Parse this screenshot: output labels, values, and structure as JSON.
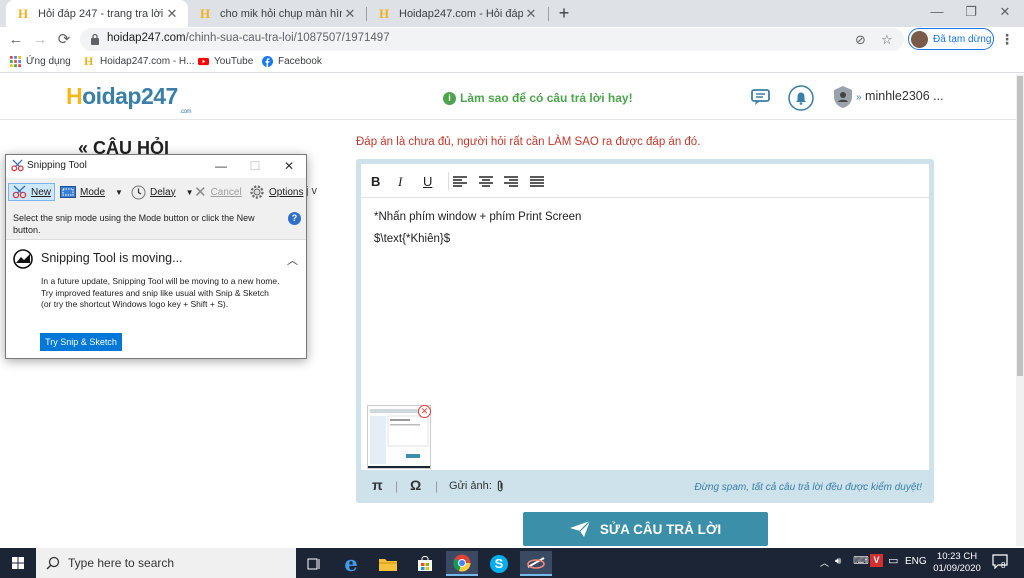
{
  "browser": {
    "tabs": [
      {
        "title": "Hỏi đáp 247 - trang tra lời",
        "active": true
      },
      {
        "title": "cho mik hỏi chụp màn hình máy",
        "active": false
      },
      {
        "title": "Hoidap247.com - Hỏi đáp online",
        "active": false
      }
    ],
    "new_tab": "+",
    "window_controls": {
      "minimize": "—",
      "maximize": "❐",
      "close": "✕"
    },
    "url_host": "hoidap247.com",
    "url_path": "/chinh-sua-cau-tra-loi/1087507/1971497",
    "profile_status": "Đã tạm dừng",
    "bookmarks": [
      "Ứng dụng",
      "Hoidap247.com - H...",
      "YouTube",
      "Facebook"
    ]
  },
  "site": {
    "logo": {
      "first": "H",
      "rest": "oidap247",
      "com": ".com"
    },
    "howto_link": "Làm sao để có câu trả lời hay!",
    "username": "minhle2306 ..."
  },
  "page": {
    "back_title": "« CÂU HỎI",
    "partial_text": "j v",
    "notice": "Đáp án là chưa đủ, người hỏi rất cần LÀM SAO ra được đáp án đó.",
    "editor": {
      "toolbar": [
        "B",
        "I",
        "U"
      ],
      "lines": [
        "*Nhấn phím window + phím Print Screen",
        "$\\text{*Khiên}$"
      ],
      "bottom": {
        "pi": "π",
        "omega": "Ω",
        "sep": "|",
        "attach_label": "Gửi ảnh:"
      },
      "spam_notice": "Đừng spam, tất cả câu trả lời đều được kiểm duyệt!"
    },
    "submit_label": "SỬA CÂU TRẢ LỜI"
  },
  "snipping_tool": {
    "title": "Snipping Tool",
    "toolbar": {
      "new": "New",
      "mode": "Mode",
      "delay": "Delay",
      "cancel": "Cancel",
      "options": "Options"
    },
    "hint": "Select the snip mode using the Mode button or click the New button.",
    "moving_title": "Snipping Tool is moving...",
    "moving_body": "In a future update, Snipping Tool will be moving to a new home. Try improved features and snip like usual with Snip & Sketch (or try the shortcut Windows logo key + Shift + S).",
    "try_button": "Try Snip & Sketch"
  },
  "taskbar": {
    "search_placeholder": "Type here to search",
    "lang": "ENG",
    "time": "10:23 CH",
    "date": "01/09/2020",
    "notifications": "8"
  }
}
